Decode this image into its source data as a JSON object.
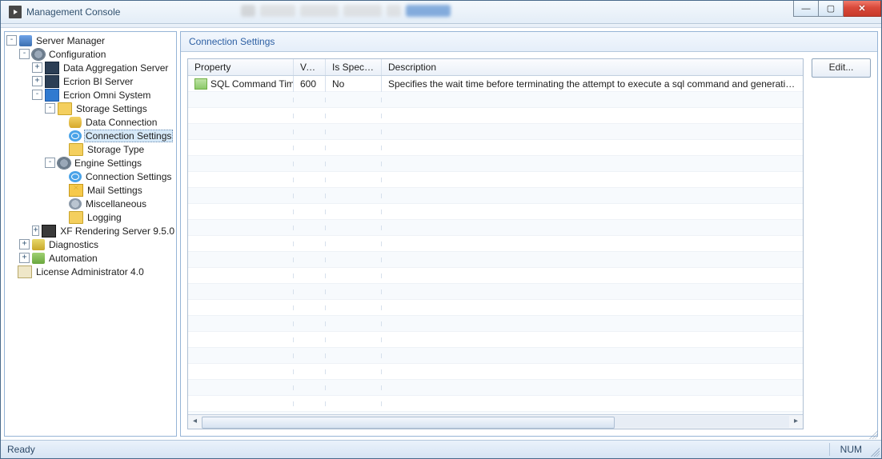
{
  "window": {
    "title": "Management Console"
  },
  "tree": {
    "root": "Server Manager",
    "configuration": "Configuration",
    "data_aggregation": "Data Aggregation Server",
    "ecrion_bi": "Ecrion BI Server",
    "ecrion_omni": "Ecrion Omni System",
    "storage_settings": "Storage Settings",
    "data_connection": "Data Connection",
    "connection_settings": "Connection Settings",
    "storage_type": "Storage Type",
    "engine_settings": "Engine Settings",
    "engine_connection": "Connection Settings",
    "mail_settings": "Mail Settings",
    "miscellaneous": "Miscellaneous",
    "logging": "Logging",
    "xf_rendering": "XF Rendering Server 9.5.0",
    "diagnostics": "Diagnostics",
    "automation": "Automation",
    "license_admin": "License Administrator 4.0"
  },
  "panel": {
    "title": "Connection Settings"
  },
  "grid": {
    "headers": {
      "property": "Property",
      "value": "Value",
      "is_specified": "Is Specified",
      "description": "Description"
    },
    "rows": [
      {
        "property": "SQL Command Timeout",
        "value": "600",
        "is_specified": "No",
        "description": "Specifies the wait time before terminating the attempt to execute a sql command and generating an error."
      }
    ]
  },
  "actions": {
    "edit": "Edit..."
  },
  "status": {
    "ready": "Ready",
    "num": "NUM"
  }
}
